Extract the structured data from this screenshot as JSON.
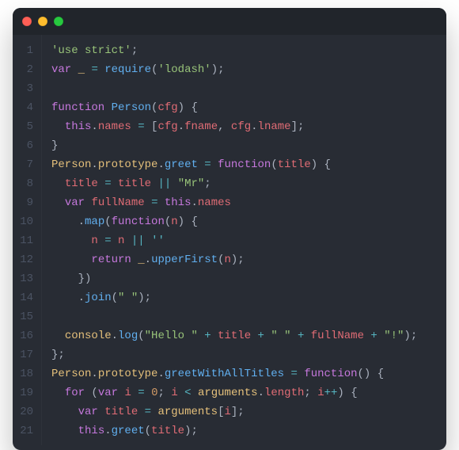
{
  "window": {
    "dots": [
      "close",
      "minimize",
      "zoom"
    ]
  },
  "colors": {
    "bg": "#282c34",
    "titlebar": "#21252b",
    "gutter": "#4b5363",
    "default": "#abb2bf",
    "keyword": "#c678dd",
    "function": "#61afef",
    "string": "#98c379",
    "stringEmpty": "#56b6c2",
    "type": "#e5c07b",
    "param": "#e06c75",
    "number": "#d19a66",
    "operator": "#56b6c2"
  },
  "lineCount": 21,
  "lineNumbers": [
    "1",
    "2",
    "3",
    "4",
    "5",
    "6",
    "7",
    "8",
    "9",
    "10",
    "11",
    "12",
    "13",
    "14",
    "15",
    "16",
    "17",
    "18",
    "19",
    "20",
    "21"
  ],
  "code": [
    [
      {
        "c": "str",
        "t": "'use strict'"
      },
      {
        "c": "p",
        "t": ";"
      }
    ],
    [
      {
        "c": "kw",
        "t": "var"
      },
      {
        "c": "p",
        "t": " "
      },
      {
        "c": "id",
        "t": "_"
      },
      {
        "c": "p",
        "t": " "
      },
      {
        "c": "op",
        "t": "="
      },
      {
        "c": "p",
        "t": " "
      },
      {
        "c": "fn",
        "t": "require"
      },
      {
        "c": "p",
        "t": "("
      },
      {
        "c": "str",
        "t": "'lodash'"
      },
      {
        "c": "p",
        "t": ");"
      }
    ],
    [
      {
        "c": "p",
        "t": ""
      }
    ],
    [
      {
        "c": "kw",
        "t": "function"
      },
      {
        "c": "p",
        "t": " "
      },
      {
        "c": "fn",
        "t": "Person"
      },
      {
        "c": "p",
        "t": "("
      },
      {
        "c": "par",
        "t": "cfg"
      },
      {
        "c": "p",
        "t": ") {"
      }
    ],
    [
      {
        "c": "p",
        "t": "  "
      },
      {
        "c": "kw",
        "t": "this"
      },
      {
        "c": "p",
        "t": "."
      },
      {
        "c": "prop",
        "t": "names"
      },
      {
        "c": "p",
        "t": " "
      },
      {
        "c": "op",
        "t": "="
      },
      {
        "c": "p",
        "t": " ["
      },
      {
        "c": "par",
        "t": "cfg"
      },
      {
        "c": "p",
        "t": "."
      },
      {
        "c": "prop",
        "t": "fname"
      },
      {
        "c": "p",
        "t": ", "
      },
      {
        "c": "par",
        "t": "cfg"
      },
      {
        "c": "p",
        "t": "."
      },
      {
        "c": "prop",
        "t": "lname"
      },
      {
        "c": "p",
        "t": "];"
      }
    ],
    [
      {
        "c": "p",
        "t": "}"
      }
    ],
    [
      {
        "c": "id",
        "t": "Person"
      },
      {
        "c": "p",
        "t": "."
      },
      {
        "c": "id",
        "t": "prototype"
      },
      {
        "c": "p",
        "t": "."
      },
      {
        "c": "fn",
        "t": "greet"
      },
      {
        "c": "p",
        "t": " "
      },
      {
        "c": "op",
        "t": "="
      },
      {
        "c": "p",
        "t": " "
      },
      {
        "c": "kw",
        "t": "function"
      },
      {
        "c": "p",
        "t": "("
      },
      {
        "c": "par",
        "t": "title"
      },
      {
        "c": "p",
        "t": ") {"
      }
    ],
    [
      {
        "c": "p",
        "t": "  "
      },
      {
        "c": "par",
        "t": "title"
      },
      {
        "c": "p",
        "t": " "
      },
      {
        "c": "op",
        "t": "="
      },
      {
        "c": "p",
        "t": " "
      },
      {
        "c": "par",
        "t": "title"
      },
      {
        "c": "p",
        "t": " "
      },
      {
        "c": "op",
        "t": "||"
      },
      {
        "c": "p",
        "t": " "
      },
      {
        "c": "str",
        "t": "\"Mr\""
      },
      {
        "c": "p",
        "t": ";"
      }
    ],
    [
      {
        "c": "p",
        "t": "  "
      },
      {
        "c": "kw",
        "t": "var"
      },
      {
        "c": "p",
        "t": " "
      },
      {
        "c": "par",
        "t": "fullName"
      },
      {
        "c": "p",
        "t": " "
      },
      {
        "c": "op",
        "t": "="
      },
      {
        "c": "p",
        "t": " "
      },
      {
        "c": "kw",
        "t": "this"
      },
      {
        "c": "p",
        "t": "."
      },
      {
        "c": "prop",
        "t": "names"
      }
    ],
    [
      {
        "c": "p",
        "t": "    ."
      },
      {
        "c": "fn",
        "t": "map"
      },
      {
        "c": "p",
        "t": "("
      },
      {
        "c": "kw",
        "t": "function"
      },
      {
        "c": "p",
        "t": "("
      },
      {
        "c": "par",
        "t": "n"
      },
      {
        "c": "p",
        "t": ") {"
      }
    ],
    [
      {
        "c": "p",
        "t": "      "
      },
      {
        "c": "par",
        "t": "n"
      },
      {
        "c": "p",
        "t": " "
      },
      {
        "c": "op",
        "t": "="
      },
      {
        "c": "p",
        "t": " "
      },
      {
        "c": "par",
        "t": "n"
      },
      {
        "c": "p",
        "t": " "
      },
      {
        "c": "op",
        "t": "||"
      },
      {
        "c": "p",
        "t": " "
      },
      {
        "c": "strE",
        "t": "''"
      }
    ],
    [
      {
        "c": "p",
        "t": "      "
      },
      {
        "c": "kw",
        "t": "return"
      },
      {
        "c": "p",
        "t": " "
      },
      {
        "c": "id",
        "t": "_"
      },
      {
        "c": "p",
        "t": "."
      },
      {
        "c": "fn",
        "t": "upperFirst"
      },
      {
        "c": "p",
        "t": "("
      },
      {
        "c": "par",
        "t": "n"
      },
      {
        "c": "p",
        "t": ");"
      }
    ],
    [
      {
        "c": "p",
        "t": "    })"
      }
    ],
    [
      {
        "c": "p",
        "t": "    ."
      },
      {
        "c": "fn",
        "t": "join"
      },
      {
        "c": "p",
        "t": "("
      },
      {
        "c": "str",
        "t": "\" \""
      },
      {
        "c": "p",
        "t": ");"
      }
    ],
    [
      {
        "c": "p",
        "t": ""
      }
    ],
    [
      {
        "c": "p",
        "t": "  "
      },
      {
        "c": "id",
        "t": "console"
      },
      {
        "c": "p",
        "t": "."
      },
      {
        "c": "fn",
        "t": "log"
      },
      {
        "c": "p",
        "t": "("
      },
      {
        "c": "str",
        "t": "\"Hello \""
      },
      {
        "c": "p",
        "t": " "
      },
      {
        "c": "op",
        "t": "+"
      },
      {
        "c": "p",
        "t": " "
      },
      {
        "c": "par",
        "t": "title"
      },
      {
        "c": "p",
        "t": " "
      },
      {
        "c": "op",
        "t": "+"
      },
      {
        "c": "p",
        "t": " "
      },
      {
        "c": "str",
        "t": "\" \""
      },
      {
        "c": "p",
        "t": " "
      },
      {
        "c": "op",
        "t": "+"
      },
      {
        "c": "p",
        "t": " "
      },
      {
        "c": "par",
        "t": "fullName"
      },
      {
        "c": "p",
        "t": " "
      },
      {
        "c": "op",
        "t": "+"
      },
      {
        "c": "p",
        "t": " "
      },
      {
        "c": "str",
        "t": "\"!\""
      },
      {
        "c": "p",
        "t": ");"
      }
    ],
    [
      {
        "c": "p",
        "t": "};"
      }
    ],
    [
      {
        "c": "id",
        "t": "Person"
      },
      {
        "c": "p",
        "t": "."
      },
      {
        "c": "id",
        "t": "prototype"
      },
      {
        "c": "p",
        "t": "."
      },
      {
        "c": "fn",
        "t": "greetWithAllTitles"
      },
      {
        "c": "p",
        "t": " "
      },
      {
        "c": "op",
        "t": "="
      },
      {
        "c": "p",
        "t": " "
      },
      {
        "c": "kw",
        "t": "function"
      },
      {
        "c": "p",
        "t": "() {"
      }
    ],
    [
      {
        "c": "p",
        "t": "  "
      },
      {
        "c": "kw",
        "t": "for"
      },
      {
        "c": "p",
        "t": " ("
      },
      {
        "c": "kw",
        "t": "var"
      },
      {
        "c": "p",
        "t": " "
      },
      {
        "c": "par",
        "t": "i"
      },
      {
        "c": "p",
        "t": " "
      },
      {
        "c": "op",
        "t": "="
      },
      {
        "c": "p",
        "t": " "
      },
      {
        "c": "num",
        "t": "0"
      },
      {
        "c": "p",
        "t": "; "
      },
      {
        "c": "par",
        "t": "i"
      },
      {
        "c": "p",
        "t": " "
      },
      {
        "c": "op",
        "t": "<"
      },
      {
        "c": "p",
        "t": " "
      },
      {
        "c": "id",
        "t": "arguments"
      },
      {
        "c": "p",
        "t": "."
      },
      {
        "c": "prop",
        "t": "length"
      },
      {
        "c": "p",
        "t": "; "
      },
      {
        "c": "par",
        "t": "i"
      },
      {
        "c": "op",
        "t": "++"
      },
      {
        "c": "p",
        "t": ") {"
      }
    ],
    [
      {
        "c": "p",
        "t": "    "
      },
      {
        "c": "kw",
        "t": "var"
      },
      {
        "c": "p",
        "t": " "
      },
      {
        "c": "par",
        "t": "title"
      },
      {
        "c": "p",
        "t": " "
      },
      {
        "c": "op",
        "t": "="
      },
      {
        "c": "p",
        "t": " "
      },
      {
        "c": "id",
        "t": "arguments"
      },
      {
        "c": "p",
        "t": "["
      },
      {
        "c": "par",
        "t": "i"
      },
      {
        "c": "p",
        "t": "];"
      }
    ],
    [
      {
        "c": "p",
        "t": "    "
      },
      {
        "c": "kw",
        "t": "this"
      },
      {
        "c": "p",
        "t": "."
      },
      {
        "c": "fn",
        "t": "greet"
      },
      {
        "c": "p",
        "t": "("
      },
      {
        "c": "par",
        "t": "title"
      },
      {
        "c": "p",
        "t": ");"
      }
    ]
  ]
}
